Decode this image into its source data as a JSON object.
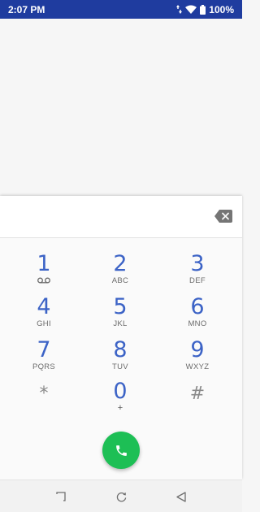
{
  "status_bar": {
    "time": "2:07 PM",
    "battery": "100%",
    "icons": [
      "data-arrows-icon",
      "wifi-icon",
      "battery-icon"
    ]
  },
  "dialpad": {
    "digits_value": "",
    "keys": [
      {
        "digit": "1",
        "letters": "",
        "icon": "voicemail-icon"
      },
      {
        "digit": "2",
        "letters": "ABC"
      },
      {
        "digit": "3",
        "letters": "DEF"
      },
      {
        "digit": "4",
        "letters": "GHI"
      },
      {
        "digit": "5",
        "letters": "JKL"
      },
      {
        "digit": "6",
        "letters": "MNO"
      },
      {
        "digit": "7",
        "letters": "PQRS"
      },
      {
        "digit": "8",
        "letters": "TUV"
      },
      {
        "digit": "9",
        "letters": "WXYZ"
      },
      {
        "digit": "*",
        "letters": ""
      },
      {
        "digit": "0",
        "letters": "+"
      },
      {
        "digit": "#",
        "letters": ""
      }
    ],
    "backspace_icon": "backspace-icon",
    "call_icon": "phone-icon"
  },
  "nav_bar": {
    "icons": [
      "recents-icon",
      "home-icon",
      "back-icon"
    ]
  },
  "colors": {
    "status_bar": "#1f3c9f",
    "digit": "#3c63c6",
    "call_button": "#1dbf55"
  }
}
